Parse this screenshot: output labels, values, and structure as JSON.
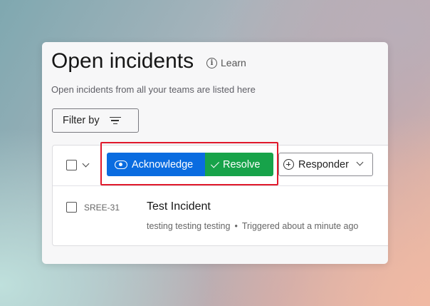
{
  "page": {
    "title": "Open incidents",
    "learn_label": "Learn",
    "subtitle": "Open incidents from all your teams are listed here"
  },
  "filter": {
    "label": "Filter by"
  },
  "toolbar": {
    "acknowledge_label": "Acknowledge",
    "resolve_label": "Resolve",
    "responder_label": "Responder"
  },
  "incidents": [
    {
      "id": "SREE-31",
      "title": "Test Incident",
      "description": "testing testing testing",
      "separator": "•",
      "status": "Triggered about a minute ago"
    }
  ],
  "colors": {
    "acknowledge": "#0a6ce0",
    "resolve": "#17a34a",
    "highlight": "#e0182b"
  },
  "icons": [
    "info-icon",
    "filter-icon",
    "chevron-down-icon",
    "eye-icon",
    "check-icon",
    "plus-circle-icon"
  ]
}
